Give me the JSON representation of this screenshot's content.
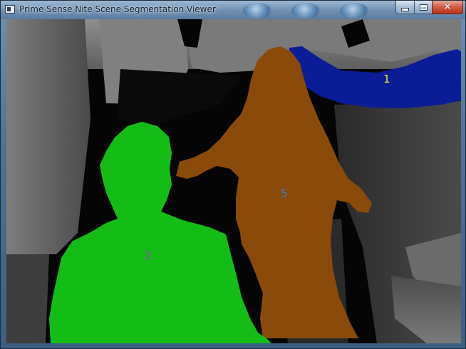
{
  "window": {
    "title": "Prime Sense Nite Scene Segmentation Viewer",
    "icon": "app-window-icon",
    "controls": {
      "minimize_icon": "minimize-icon",
      "maximize_icon": "maximize-icon",
      "close_icon": "close-icon"
    }
  },
  "scene": {
    "users": [
      {
        "id": "1",
        "label": "1",
        "color": "#0a1c96",
        "label_color": "#f2e63a"
      },
      {
        "id": "2",
        "label": "2",
        "color": "#13bd16",
        "label_color": "#9a48b4"
      },
      {
        "id": "5",
        "label": "5",
        "color": "#8a4a0a",
        "label_color": "#3f7fc9"
      }
    ],
    "depth_background_colors": [
      "#9a9a9a",
      "#6a6a6a",
      "#3a3a3a",
      "#000000"
    ]
  }
}
